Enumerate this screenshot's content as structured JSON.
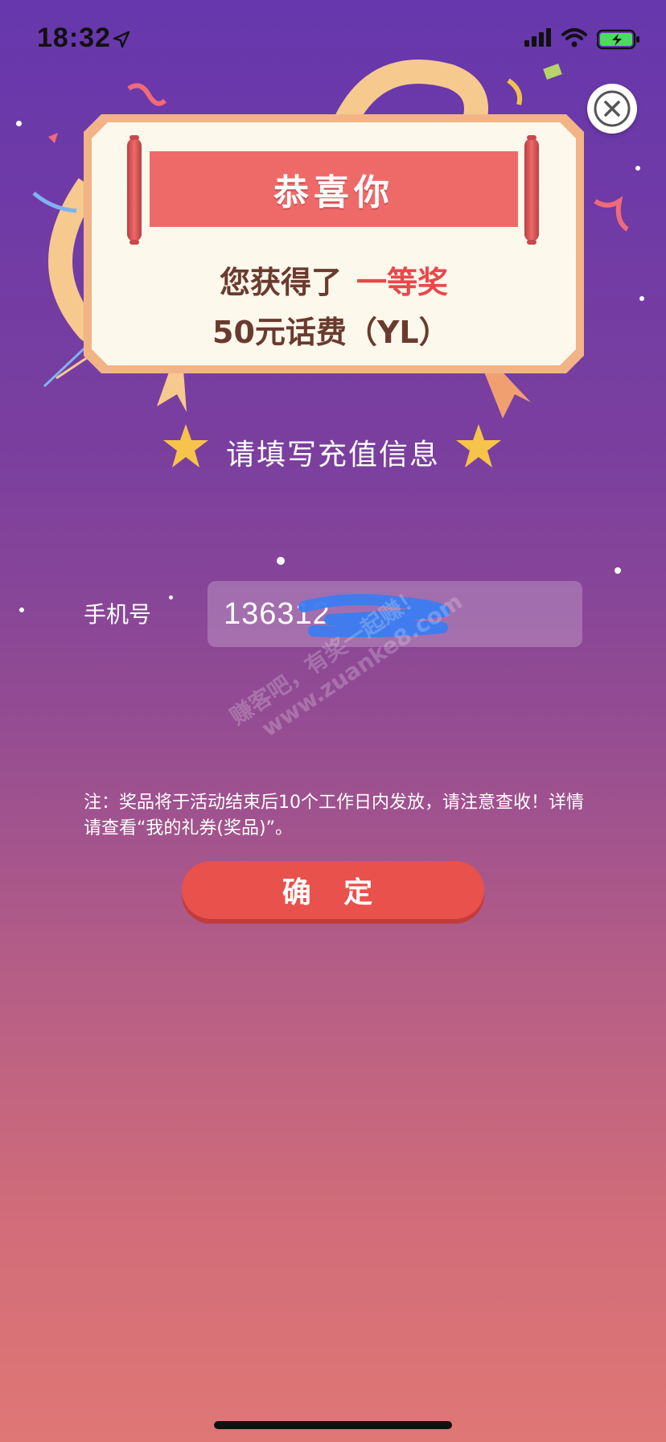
{
  "status_bar": {
    "time": "18:32"
  },
  "dialog": {
    "banner_title": "恭喜你",
    "prize_prefix": "您获得了",
    "prize_level": "一等奖",
    "prize_name": "50元话费（YL）"
  },
  "form": {
    "section_title": "请填写充值信息",
    "phone_label": "手机号",
    "phone_value": "136312"
  },
  "watermark": {
    "line1": "赚客吧，有奖一起赚！",
    "line2": "www.zuanke8.com"
  },
  "notice": "注：奖品将于活动结束后10个工作日内发放，请注意查收！详情请查看“我的礼券(奖品)”。",
  "confirm_button": "确 定",
  "colors": {
    "accent_red": "#ee6a69",
    "button_red": "#e9514c",
    "card_border": "#f2b486",
    "card_bg": "#fdf8ec"
  }
}
